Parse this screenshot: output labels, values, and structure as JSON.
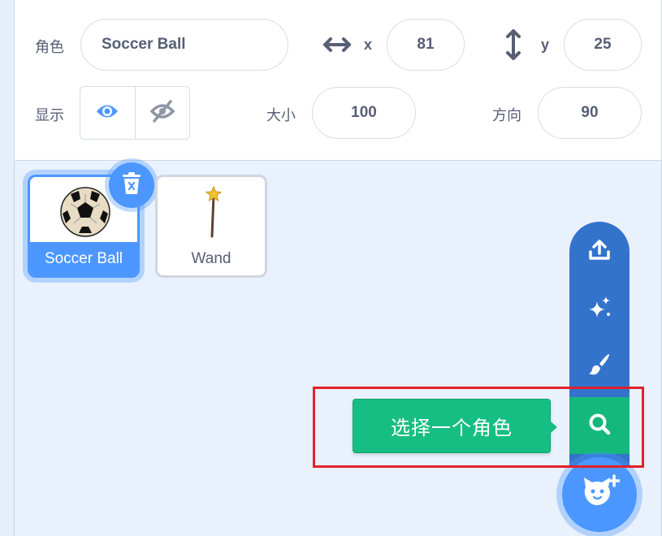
{
  "sprite_info": {
    "sprite_label": "角色",
    "sprite_name": "Soccer Ball",
    "x_label": "x",
    "x_value": "81",
    "y_label": "y",
    "y_value": "25",
    "show_label": "显示",
    "size_label": "大小",
    "size_value": "100",
    "direction_label": "方向",
    "direction_value": "90"
  },
  "sprites": [
    {
      "name": "Soccer Ball",
      "selected": true
    },
    {
      "name": "Wand",
      "selected": false
    }
  ],
  "sprite_menu": {
    "items": [
      "upload-icon",
      "surprise-icon",
      "paint-icon",
      "search-icon"
    ],
    "tooltip": "选择一个角色",
    "add_button": "cat-add-icon"
  },
  "colors": {
    "accent_blue": "#4c97ff",
    "menu_blue": "#3373cc",
    "active_green": "#14b87d",
    "highlight_red": "#e3202a"
  }
}
